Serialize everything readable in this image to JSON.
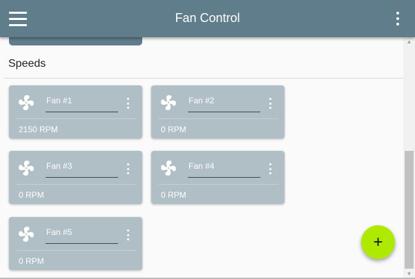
{
  "app_bar": {
    "title": "Fan Control",
    "menu_icon": "hamburger-menu-icon",
    "overflow_icon": "more-vert-icon",
    "background": "#607d8b"
  },
  "section": {
    "title": "Speeds"
  },
  "fans": [
    {
      "name": "Fan #1",
      "rpm": "2150 RPM",
      "icon": "fan-icon"
    },
    {
      "name": "Fan #2",
      "rpm": "0 RPM",
      "icon": "fan-icon"
    },
    {
      "name": "Fan #3",
      "rpm": "0 RPM",
      "icon": "fan-icon"
    },
    {
      "name": "Fan #4",
      "rpm": "0 RPM",
      "icon": "fan-icon"
    },
    {
      "name": "Fan #5",
      "rpm": "0 RPM",
      "icon": "fan-icon"
    }
  ],
  "fab": {
    "label": "+",
    "icon": "add-icon",
    "color": "#aeea00"
  },
  "card_color": "#b0bec5"
}
